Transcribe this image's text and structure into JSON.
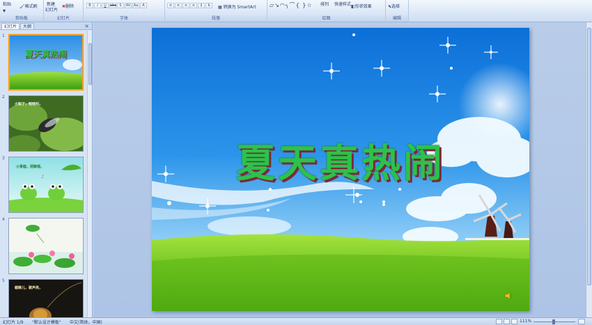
{
  "ribbon": {
    "groups": {
      "clipboard": "剪贴板",
      "slides": "幻灯片",
      "font": "字体",
      "paragraph": "段落",
      "drawing": "绘图",
      "editing": "编辑"
    },
    "paste": "粘贴",
    "format_painter": "格式刷",
    "new_slide_line1": "新建",
    "new_slide_line2": "幻灯片",
    "delete": "删除",
    "convert_smartart": "转换为 SmartArt",
    "arrange": "排列",
    "quick_styles": "快速样式",
    "shape_effects": "形状效果",
    "select": "选择"
  },
  "outline_pane": {
    "tab_slides": "幻灯片",
    "tab_outline": "大纲",
    "close": "×",
    "thumbs": [
      {
        "num": "1",
        "title": "夏天真热闹"
      },
      {
        "num": "2",
        "title": "小知了，吱吱叫，"
      },
      {
        "num": "3",
        "title": "小青蛙，把歌唱，"
      },
      {
        "num": "4",
        "title": ""
      },
      {
        "num": "5",
        "title": "蟋蟀儿，歌声亮，"
      }
    ]
  },
  "slide": {
    "title": "夏天真热闹"
  },
  "status": {
    "slide_counter": "幻灯片 1/9",
    "theme": "\"默认设计模板\"",
    "language": "中文(简体，中国)",
    "zoom": "111%"
  },
  "colors": {
    "title_green": "#2cc24a",
    "title_shadow": "#7a2a3a",
    "selection": "#f5a030"
  }
}
